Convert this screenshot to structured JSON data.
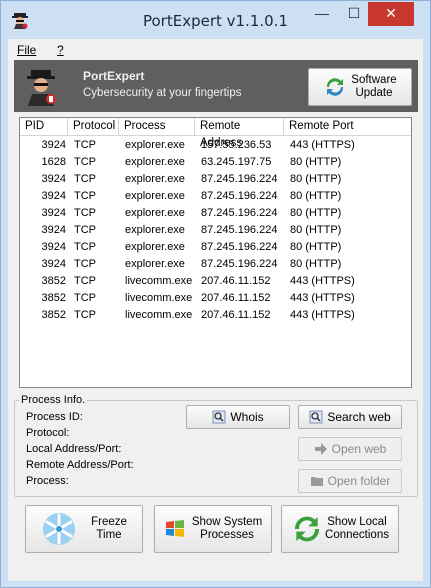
{
  "window": {
    "title": "PortExpert v1.1.0.1",
    "controls": {
      "minimize": "—",
      "maximize": "☐",
      "close": "✕"
    }
  },
  "menu": {
    "file": "File",
    "help": "?"
  },
  "banner": {
    "title": "PortExpert",
    "subtitle": "Cybersecurity at your fingertips",
    "update_line1": "Software",
    "update_line2": "Update"
  },
  "table": {
    "columns": [
      "PID",
      "Protocol",
      "Process",
      "Remote Address",
      "Remote Port"
    ],
    "rows": [
      [
        "3924",
        "TCP",
        "explorer.exe",
        "157.55.236.53",
        "443 (HTTPS)"
      ],
      [
        "1628",
        "TCP",
        "explorer.exe",
        "63.245.197.75",
        "80 (HTTP)"
      ],
      [
        "3924",
        "TCP",
        "explorer.exe",
        "87.245.196.224",
        "80 (HTTP)"
      ],
      [
        "3924",
        "TCP",
        "explorer.exe",
        "87.245.196.224",
        "80 (HTTP)"
      ],
      [
        "3924",
        "TCP",
        "explorer.exe",
        "87.245.196.224",
        "80 (HTTP)"
      ],
      [
        "3924",
        "TCP",
        "explorer.exe",
        "87.245.196.224",
        "80 (HTTP)"
      ],
      [
        "3924",
        "TCP",
        "explorer.exe",
        "87.245.196.224",
        "80 (HTTP)"
      ],
      [
        "3924",
        "TCP",
        "explorer.exe",
        "87.245.196.224",
        "80 (HTTP)"
      ],
      [
        "3852",
        "TCP",
        "livecomm.exe",
        "207.46.11.152",
        "443 (HTTPS)"
      ],
      [
        "3852",
        "TCP",
        "livecomm.exe",
        "207.46.11.152",
        "443 (HTTPS)"
      ],
      [
        "3852",
        "TCP",
        "livecomm.exe",
        "207.46.11.152",
        "443 (HTTPS)"
      ]
    ]
  },
  "process_info": {
    "title": "Process Info.",
    "labels": [
      "Process ID:",
      "Protocol:",
      "Local Address/Port:",
      "Remote Address/Port:",
      "Process:"
    ],
    "whois": "Whois",
    "search_web": "Search web",
    "open_web": "Open web",
    "open_folder": "Open folder"
  },
  "bottom": {
    "freeze_line1": "Freeze",
    "freeze_line2": "Time",
    "sys_line1": "Show System",
    "sys_line2": "Processes",
    "local_line1": "Show Local",
    "local_line2": "Connections"
  },
  "colors": {
    "close": "#c7372e",
    "banner": "#5f5f5f",
    "window_frame": "#cde0f3"
  },
  "icons": {
    "app": "spy-icon",
    "update": "refresh-icon",
    "whois": "magnifier-icon",
    "search": "magnifier-icon",
    "open_web": "arrow-right-icon",
    "open_folder": "folder-icon",
    "freeze": "snowflake-icon",
    "system": "windows-logo-icon",
    "local": "refresh-icon"
  }
}
